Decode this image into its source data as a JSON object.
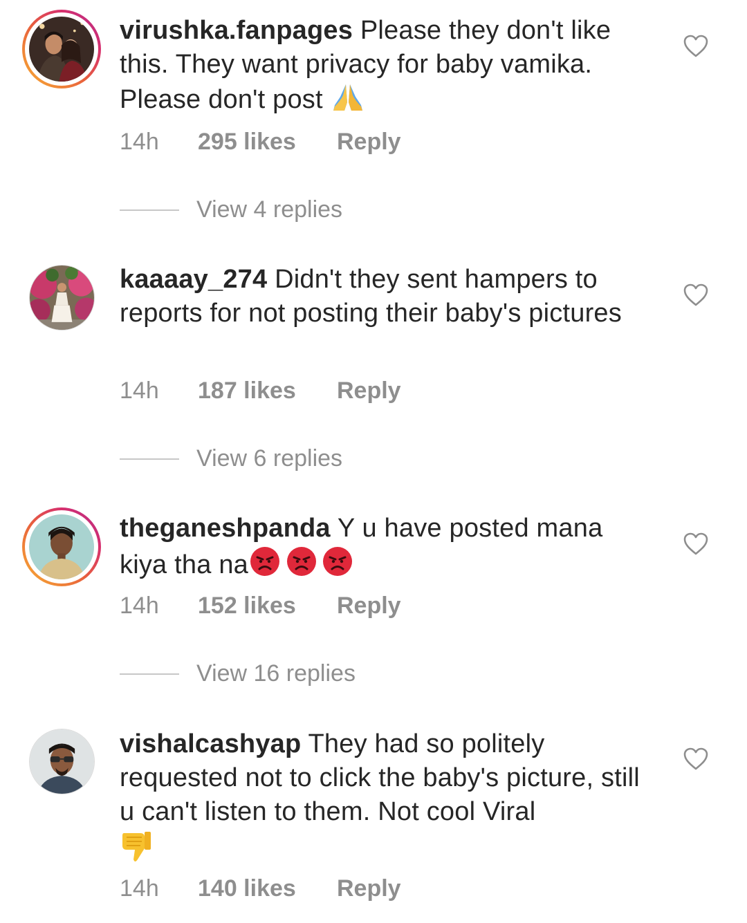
{
  "comments": [
    {
      "username": "virushka.fanpages",
      "text": "Please they don't like this. They want privacy for baby vamika. Please don't post",
      "emoji": "folded-hands-icon",
      "time": "14h",
      "likes": "295 likes",
      "reply": "Reply",
      "view_replies": "View 4 replies"
    },
    {
      "username": "kaaaay_274",
      "text": "Didn't they sent hampers to reports for not posting their baby's pictures",
      "time": "14h",
      "likes": "187 likes",
      "reply": "Reply",
      "view_replies": "View 6 replies"
    },
    {
      "username": "theganeshpanda",
      "text": "Y u have posted mana kiya tha na",
      "emoji": "angry-face-icon",
      "time": "14h",
      "likes": "152 likes",
      "reply": "Reply",
      "view_replies": "View 16 replies"
    },
    {
      "username": "vishalcashyap",
      "text": "They had so politely requested not to click the baby's picture, still u can't listen to them. Not cool Viral",
      "emoji": "thumbs-down-icon",
      "time": "14h",
      "likes": "140 likes",
      "reply": "Reply"
    }
  ]
}
